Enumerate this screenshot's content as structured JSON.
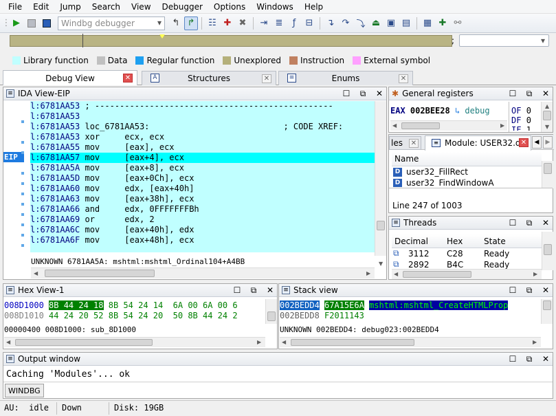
{
  "menu": [
    "File",
    "Edit",
    "Jump",
    "Search",
    "View",
    "Debugger",
    "Options",
    "Windows",
    "Help"
  ],
  "toolbar": {
    "debugger_select": "Windbg debugger"
  },
  "legend": [
    {
      "label": "Library function",
      "color": "#c0ffff"
    },
    {
      "label": "Data",
      "color": "#c0c0c0"
    },
    {
      "label": "Regular function",
      "color": "#1ea0f0"
    },
    {
      "label": "Unexplored",
      "color": "#b5b07a"
    },
    {
      "label": "Instruction",
      "color": "#c08060"
    },
    {
      "label": "External symbol",
      "color": "#ffa0ff"
    }
  ],
  "tabs": [
    {
      "label": "Debug View"
    },
    {
      "label": "Structures"
    },
    {
      "label": "Enums"
    }
  ],
  "ida": {
    "title": "IDA View-EIP",
    "eip_tag": "EIP",
    "lines": [
      {
        "addr": "l:6781AA53",
        "text": " ; ------------------------------------------------"
      },
      {
        "addr": "l:6781AA53",
        "text": ""
      },
      {
        "addr": "l:6781AA53",
        "text": " loc_6781AA53:                           ; CODE XREF:"
      },
      {
        "addr": "l:6781AA53",
        "text": " xor     ecx, ecx"
      },
      {
        "addr": "l:6781AA55",
        "text": " mov     [eax], ecx"
      },
      {
        "addr": "l:6781AA57",
        "text": " mov     [eax+4], ecx"
      },
      {
        "addr": "l:6781AA5A",
        "text": " mov     [eax+8], ecx"
      },
      {
        "addr": "l:6781AA5D",
        "text": " mov     [eax+0Ch], ecx"
      },
      {
        "addr": "l:6781AA60",
        "text": " mov     edx, [eax+40h]"
      },
      {
        "addr": "l:6781AA63",
        "text": " mov     [eax+38h], ecx"
      },
      {
        "addr": "l:6781AA66",
        "text": " and     edx, 0FFFFFFFBh"
      },
      {
        "addr": "l:6781AA69",
        "text": " or      edx, 2"
      },
      {
        "addr": "l:6781AA6C",
        "text": " mov     [eax+40h], edx"
      },
      {
        "addr": "l:6781AA6F",
        "text": " mov     [eax+48h], ecx"
      }
    ],
    "status": "UNKNOWN 6781AA5A: mshtml:mshtml_Ordinal104+A4BB"
  },
  "regs": {
    "title": "General registers",
    "eax_name": "EAX",
    "eax_val": "002BEE28",
    "eax_ref": "debug",
    "flags": [
      {
        "n": "OF",
        "v": "0"
      },
      {
        "n": "DF",
        "v": "0"
      },
      {
        "n": "IF",
        "v": "1"
      }
    ]
  },
  "modules": {
    "tab_prev": "les",
    "tab_label": "Module: USER32.dll",
    "col": "Name",
    "items": [
      "user32_FillRect",
      "user32_FindWindowA"
    ],
    "status": "Line 247 of 1003"
  },
  "threads": {
    "title": "Threads",
    "cols": [
      "Decimal",
      "Hex",
      "State"
    ],
    "rows": [
      {
        "dec": "3112",
        "hex": "C28",
        "state": "Ready"
      },
      {
        "dec": "2892",
        "hex": "B4C",
        "state": "Ready"
      }
    ]
  },
  "hex": {
    "title": "Hex View-1",
    "rows": [
      {
        "addr": "008D1000",
        "sel": "8B 44 24 18",
        "rest": " 8B 54 24 14  6A 00 6A 00 6"
      },
      {
        "addr": "008D1010",
        "sel": "",
        "rest": "44 24 20 52 8B 54 24 20  50 8B 44 24 2"
      }
    ],
    "status": "00000400 008D1000: sub_8D1000"
  },
  "stack": {
    "title": "Stack view",
    "rows": [
      {
        "addr": "002BEDD4",
        "val": "67A15E6A",
        "ref": "mshtml:mshtml_CreateHTMLProp"
      },
      {
        "addr": "002BEDD8",
        "val": "F2011143",
        "ref": ""
      }
    ],
    "status": "UNKNOWN 002BEDD4: debug023:002BEDD4"
  },
  "output": {
    "title": "Output window",
    "text": "Caching 'Modules'... ok",
    "button": "WINDBG"
  },
  "statusbar": {
    "state": "AU:  idle",
    "dir": "Down",
    "disk": "Disk: 19GB"
  }
}
